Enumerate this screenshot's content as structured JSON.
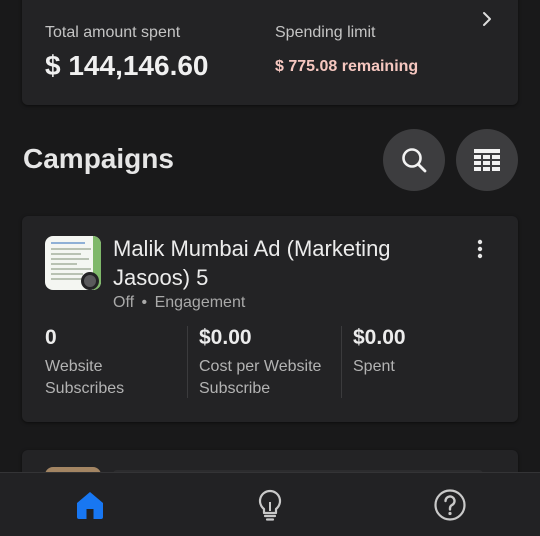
{
  "summary": {
    "total_label": "Total amount spent",
    "total_value": "$ 144,146.60",
    "limit_label": "Spending limit",
    "limit_value": "$ 775.08 remaining",
    "limit_color": "#f6c7c0"
  },
  "campaigns": {
    "title": "Campaigns",
    "search_icon": "search-icon",
    "table_icon": "table-icon",
    "items": [
      {
        "name": "Malik Mumbai Ad (Marketing Jasoos) 5",
        "status": "Off",
        "separator": "•",
        "objective": "Engagement",
        "metrics": [
          {
            "value": "0",
            "label": "Website Subscribes"
          },
          {
            "value": "$0.00",
            "label": "Cost per Website Subscribe"
          },
          {
            "value": "$0.00",
            "label": "Spent"
          }
        ]
      }
    ]
  },
  "nav": {
    "items": [
      {
        "icon": "home-icon",
        "active": true
      },
      {
        "icon": "lightbulb-icon",
        "active": false
      },
      {
        "icon": "help-icon",
        "active": false
      }
    ],
    "accent": "#1877f2"
  }
}
